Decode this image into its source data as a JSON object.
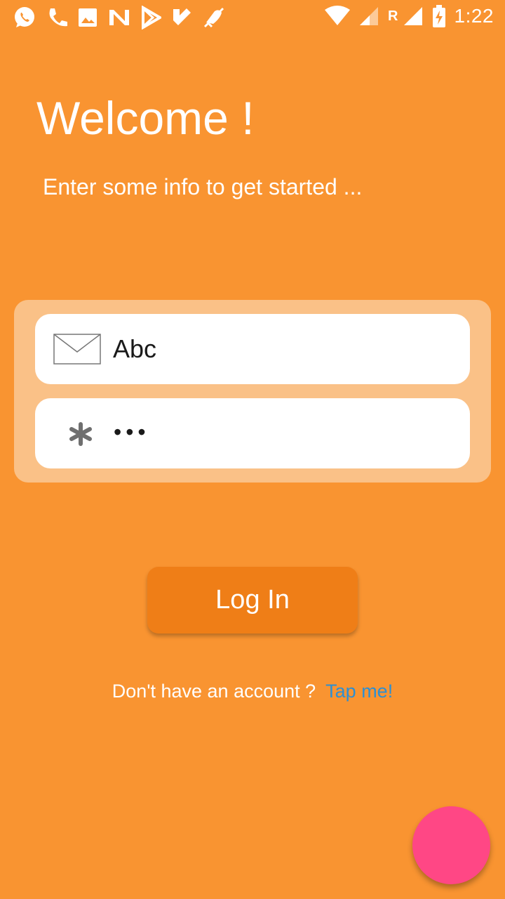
{
  "status_bar": {
    "time": "1:22",
    "roaming_label": "R",
    "notification_icons": [
      "whatsapp-icon",
      "phone-icon",
      "image-icon",
      "n-icon",
      "play-store-icon",
      "check-icon",
      "mute-icon"
    ],
    "system_icons": [
      "wifi-icon",
      "signal-icon",
      "battery-charging-icon"
    ]
  },
  "header": {
    "title": "Welcome !",
    "subtitle": "Enter some info to get started ..."
  },
  "form": {
    "email": {
      "value": "Abc",
      "icon": "envelope-icon"
    },
    "password": {
      "value": "•••",
      "icon": "asterisk-icon"
    }
  },
  "login_button": {
    "label": "Log In"
  },
  "signup": {
    "prompt": "Don't have an account ?",
    "link": "Tap me!"
  },
  "colors": {
    "background": "#F99431",
    "card": "#FAC187",
    "button": "#EF7E17",
    "link": "#2D8FD2",
    "fab": "#FF4785"
  }
}
